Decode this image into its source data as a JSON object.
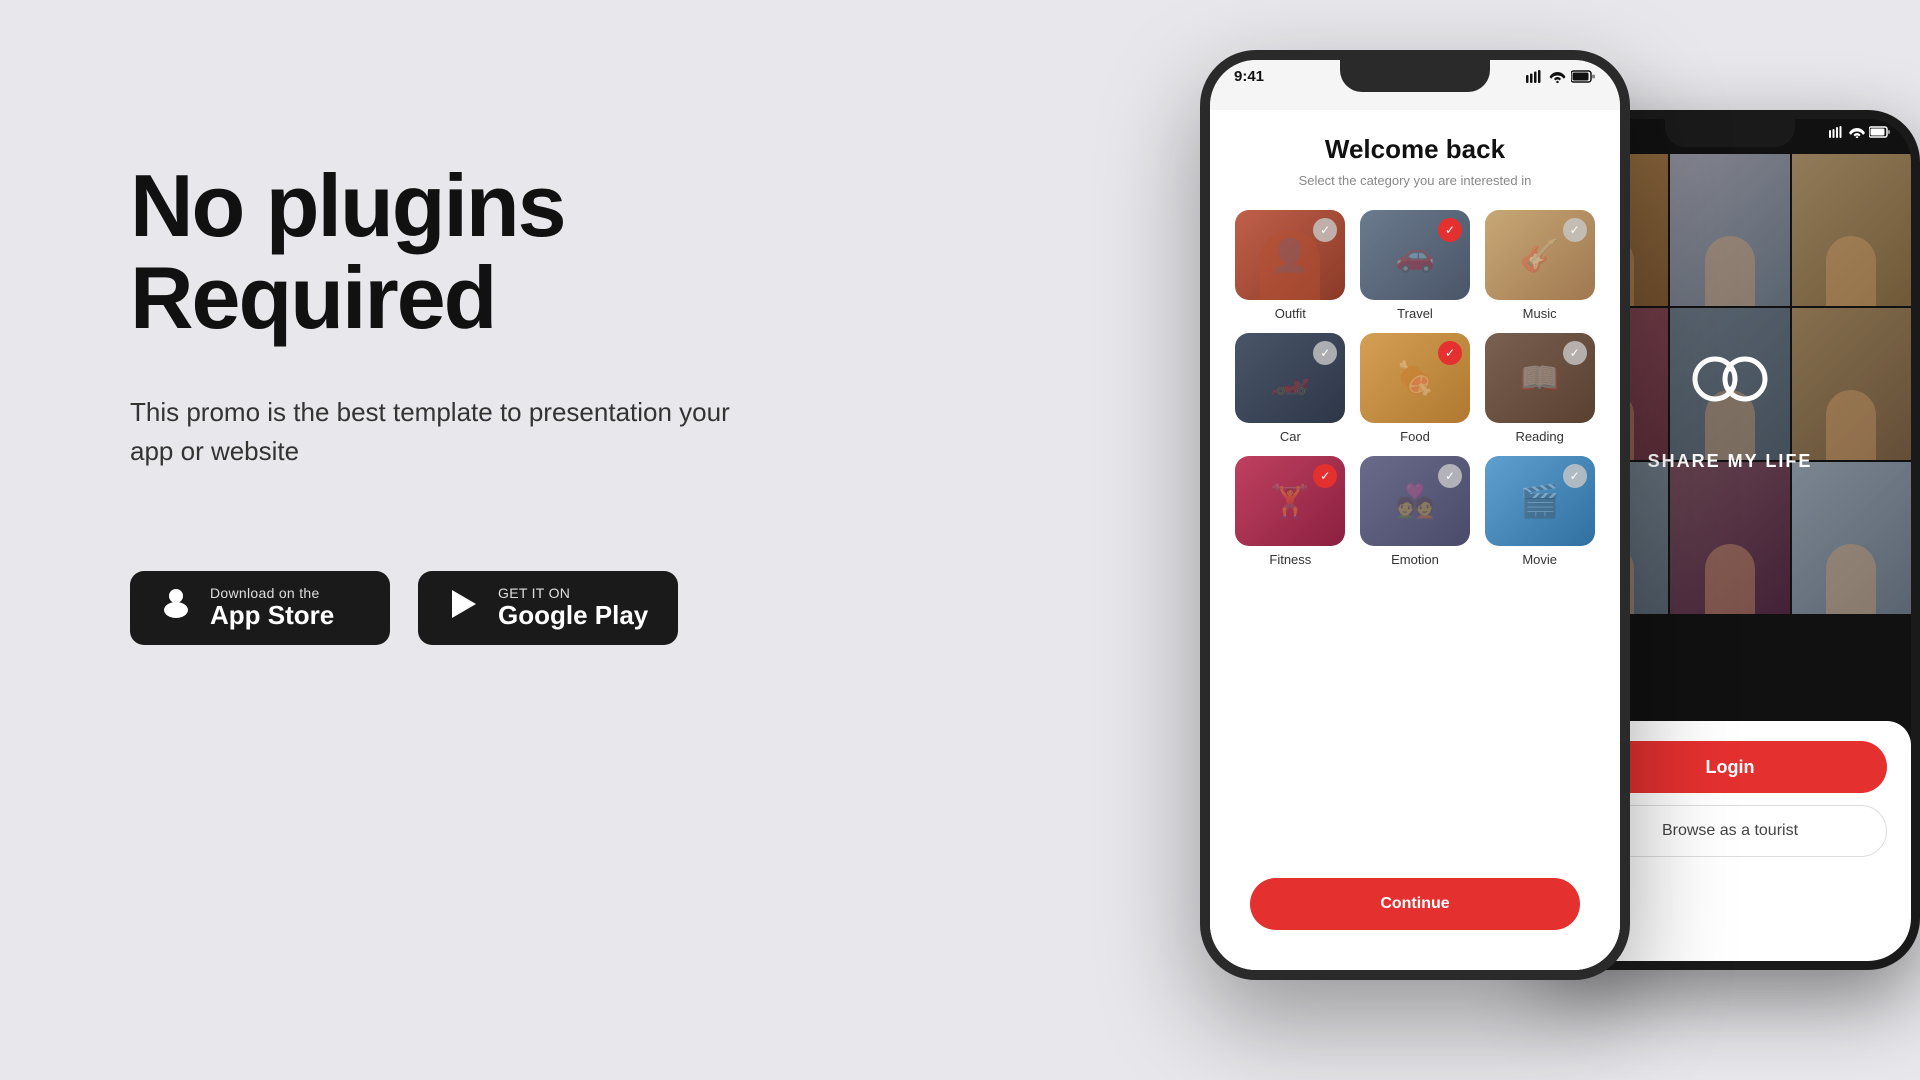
{
  "background_color": "#e8e8ec",
  "left": {
    "heading_line1": "No plugins",
    "heading_line2": "Required",
    "description": "This promo is the best template to presentation your app or website",
    "app_store": {
      "top_label": "Download on the",
      "bottom_label": "App Store",
      "icon": "⬤"
    },
    "google_play": {
      "top_label": "GET IT ON",
      "bottom_label": "Google Play",
      "icon": "▶"
    }
  },
  "phone_front": {
    "status_time": "9:41",
    "welcome_title": "Welcome back",
    "welcome_sub": "Select the category you are interested in",
    "categories": [
      {
        "label": "Outfit",
        "color_class": "cat-outfit",
        "checked": true,
        "check_color": "gray"
      },
      {
        "label": "Travel",
        "color_class": "cat-travel",
        "checked": true,
        "check_color": "red"
      },
      {
        "label": "Music",
        "color_class": "cat-music",
        "checked": true,
        "check_color": "gray"
      },
      {
        "label": "Car",
        "color_class": "cat-car",
        "checked": true,
        "check_color": "gray"
      },
      {
        "label": "Food",
        "color_class": "cat-food",
        "checked": true,
        "check_color": "red"
      },
      {
        "label": "Reading",
        "color_class": "cat-reading",
        "checked": true,
        "check_color": "gray"
      },
      {
        "label": "Fitness",
        "color_class": "cat-fitness",
        "checked": true,
        "check_color": "red"
      },
      {
        "label": "Emotion",
        "color_class": "cat-emotion",
        "checked": true,
        "check_color": "gray"
      },
      {
        "label": "Movie",
        "color_class": "cat-movie",
        "checked": true,
        "check_color": "gray"
      }
    ],
    "continue_btn": "Continue"
  },
  "phone_back": {
    "app_name": "SHARE MY LIFE",
    "login_label": "Login",
    "tourist_label": "Browse as a tourist"
  }
}
